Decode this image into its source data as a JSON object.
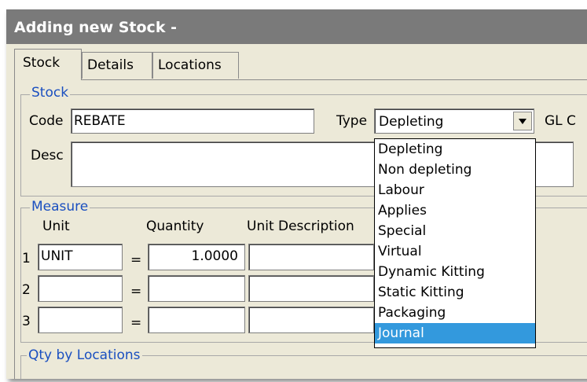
{
  "window": {
    "title": "Adding new Stock -"
  },
  "tabs": [
    {
      "label": "Stock"
    },
    {
      "label": "Details"
    },
    {
      "label": "Locations"
    }
  ],
  "stock_group": {
    "legend": "Stock",
    "code_label": "Code",
    "code_value": "REBATE",
    "type_label": "Type",
    "type_value": "Depleting",
    "gl_label": "GL C",
    "desc_label": "Desc",
    "desc_value": ""
  },
  "type_options": [
    {
      "label": "Depleting",
      "selected": false
    },
    {
      "label": "Non depleting",
      "selected": false
    },
    {
      "label": "Labour",
      "selected": false
    },
    {
      "label": "Applies",
      "selected": false
    },
    {
      "label": "Special",
      "selected": false
    },
    {
      "label": "Virtual",
      "selected": false
    },
    {
      "label": "Dynamic Kitting",
      "selected": false
    },
    {
      "label": "Static Kitting",
      "selected": false
    },
    {
      "label": "Packaging",
      "selected": false
    },
    {
      "label": "Journal",
      "selected": true
    }
  ],
  "measure_group": {
    "legend": "Measure",
    "col_unit": "Unit",
    "col_quantity": "Quantity",
    "col_unit_description": "Unit Description",
    "rows": [
      {
        "index": "1",
        "unit": "UNIT",
        "eq": "=",
        "quantity": "1.0000",
        "description": ""
      },
      {
        "index": "2",
        "unit": "",
        "eq": "=",
        "quantity": "",
        "description": ""
      },
      {
        "index": "3",
        "unit": "",
        "eq": "=",
        "quantity": "",
        "description": ""
      }
    ]
  },
  "qty_group": {
    "legend": "Qty by Locations"
  },
  "colors": {
    "titlebar": "#7a7a7a",
    "panel": "#ece9d8",
    "legend": "#1a4fc0",
    "selection": "#3399dd"
  }
}
